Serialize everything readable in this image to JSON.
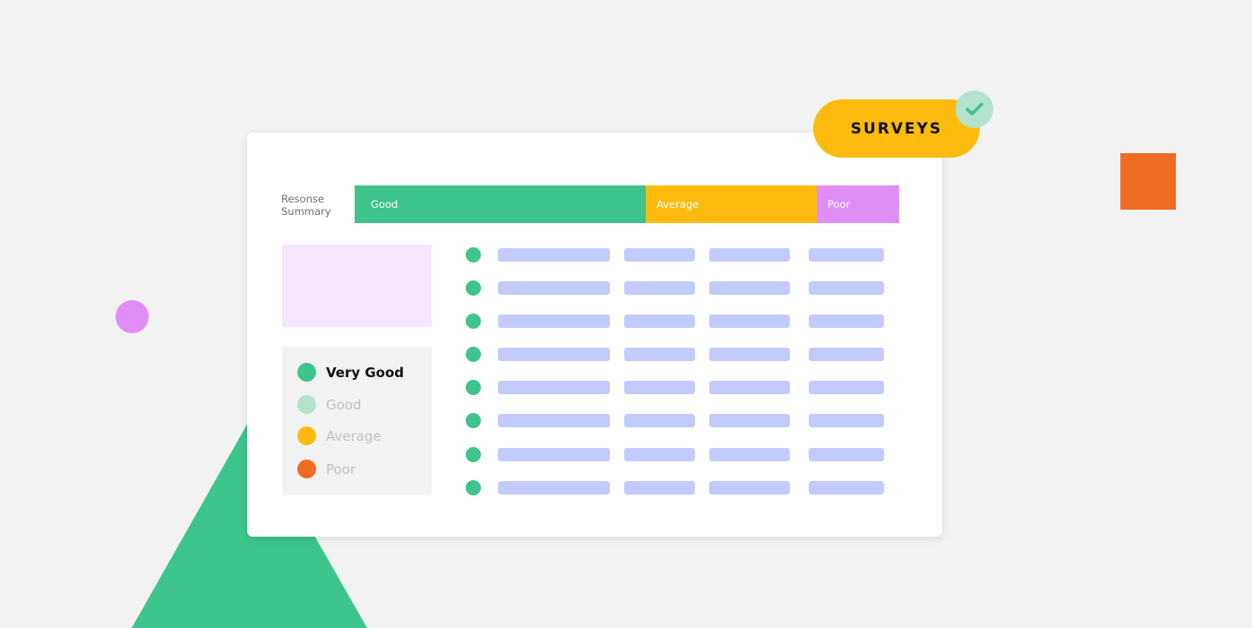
{
  "header": {
    "badge_label": "SURVEYS"
  },
  "summary": {
    "label": "Resonse\nSummary",
    "segments": [
      {
        "label": "Good",
        "fraction": 0.535,
        "color": "#3ec48d"
      },
      {
        "label": "Average",
        "fraction": 0.314,
        "color": "#fdbb0f"
      },
      {
        "label": "Poor",
        "fraction": 0.151,
        "color": "#e08ef7"
      }
    ]
  },
  "legend": {
    "items": [
      {
        "label": "Very Good",
        "color": "#3ec48d",
        "active": true
      },
      {
        "label": "Good",
        "color": "#b3e3cc",
        "active": false
      },
      {
        "label": "Average",
        "color": "#fdbb0f",
        "active": false
      },
      {
        "label": "Poor",
        "color": "#f06b22",
        "active": false
      }
    ]
  },
  "table": {
    "row_count": 8,
    "status_color": "#3ec48d",
    "placeholder_color": "#c3cbfc"
  },
  "decorations": {
    "pink_circle": "#e08ef7",
    "orange_square": "#f06b22",
    "green_triangle": "#3ec48d"
  },
  "icons": {
    "badge_check": "check-icon"
  }
}
